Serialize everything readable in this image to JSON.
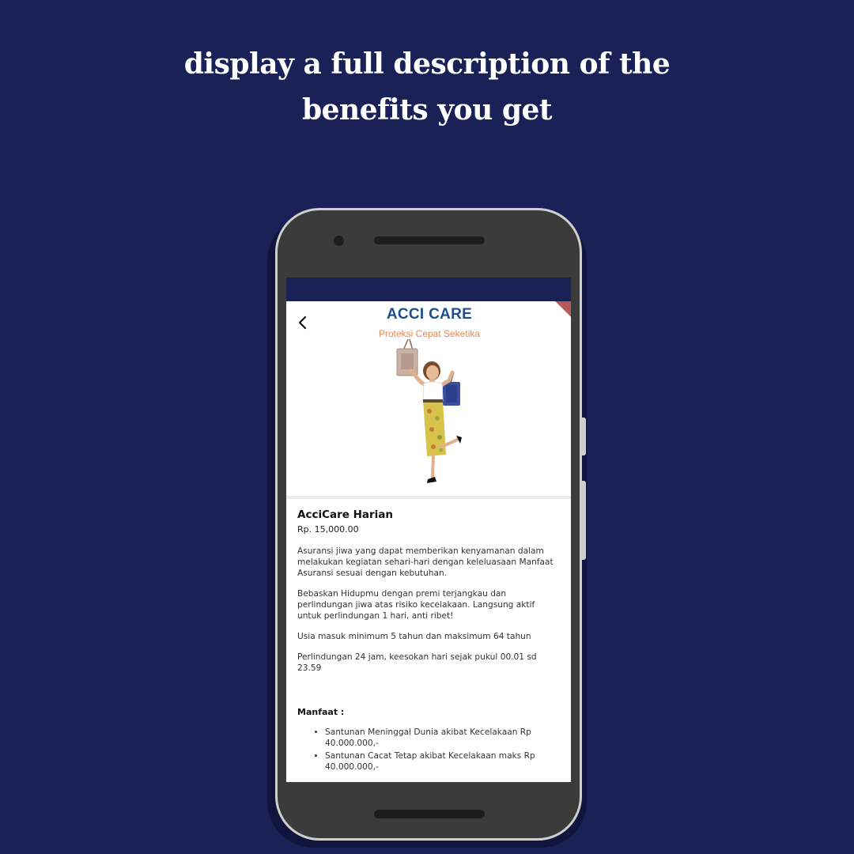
{
  "headline": {
    "line1": "display a full description of the",
    "line2": "benefits you get"
  },
  "colors": {
    "background": "#1a2156",
    "brand_blue": "#1e4f8c",
    "tagline_orange": "#e08a5a"
  },
  "app": {
    "back_icon": "chevron-left-icon",
    "banner": {
      "title": "ACCI CARE",
      "tagline": "Proteksi Cepat Seketika"
    },
    "product": {
      "name": "AcciCare Harian",
      "price": "Rp. 15,000.00",
      "paragraphs": [
        "Asuransi jiwa yang dapat memberikan kenyamanan dalam melakukan kegiatan sehari-hari dengan keleluasaan Manfaat Asuransi sesuai dengan kebutuhan.",
        "Bebaskan Hidupmu dengan premi terjangkau dan perlindungan jiwa atas risiko kecelakaan. Langsung aktif untuk perlindungan 1 hari, anti ribet!",
        "Usia masuk minimum 5 tahun dan maksimum 64 tahun",
        "Perlindungan 24 jam, keesokan hari sejak pukul 00.01 sd 23.59"
      ],
      "benefits_heading": "Manfaat :",
      "benefits": [
        "Santunan Meninggal Dunia akibat Kecelakaan Rp 40.000.000,-",
        "Santunan Cacat Tetap akibat Kecelakaan maks Rp 40.000.000,-"
      ]
    }
  }
}
